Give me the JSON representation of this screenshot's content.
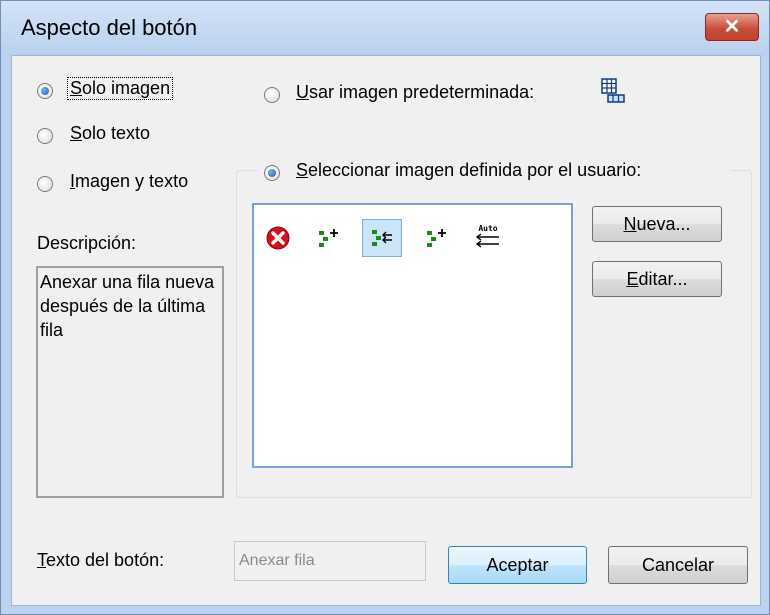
{
  "window": {
    "title": "Aspecto del botón",
    "close_glyph": "✕"
  },
  "mode": {
    "options": [
      {
        "prefix": "",
        "key": "S",
        "rest": "olo imagen",
        "checked": true
      },
      {
        "prefix": "",
        "key": "S",
        "rest": "olo texto",
        "checked": false
      },
      {
        "prefix": "",
        "key": "I",
        "rest": "magen y texto",
        "checked": false
      }
    ]
  },
  "image_source": {
    "default": {
      "key": "U",
      "rest": "sar imagen predeterminada:",
      "checked": false,
      "icon": "table-append-row-icon"
    },
    "user": {
      "key": "S",
      "rest": "eleccionar imagen definida por el usuario:",
      "checked": true
    },
    "icons": [
      "error-x-icon",
      "tree-add-icon",
      "tree-indent-icon",
      "tree-add-icon",
      "auto-arrows-icon"
    ],
    "auto_icon_text": "Auto",
    "selected_index": 2
  },
  "buttons": {
    "new": {
      "key": "N",
      "rest": "ueva..."
    },
    "edit": {
      "key": "E",
      "rest": "ditar..."
    },
    "ok": "Aceptar",
    "cancel": "Cancelar"
  },
  "description": {
    "label": "Descripción:",
    "text": "Anexar una fila nueva después de la última fila"
  },
  "button_text": {
    "label_key": "T",
    "label_rest": "exto del botón:",
    "value": "Anexar fila"
  },
  "colors": {
    "accent": "#1c57b3",
    "selection": "#cce4f7",
    "icon_green": "#1a8a1a",
    "icon_red": "#d4111a"
  }
}
